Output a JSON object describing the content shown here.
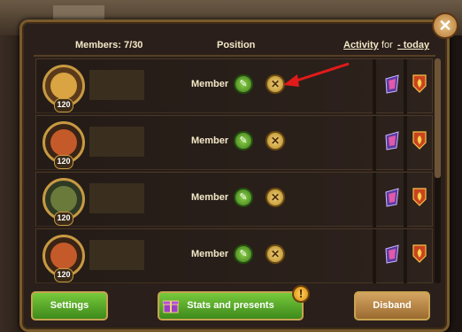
{
  "header": {
    "members": "Members: 7/30",
    "position": "Position",
    "activity": "Activity",
    "for": "for",
    "period": "- today"
  },
  "close_icon": "close-icon",
  "members": [
    {
      "level": "120",
      "role": "Member",
      "avatar_color": "#d9a441"
    },
    {
      "level": "120",
      "role": "Member",
      "avatar_color": "#c45a2a"
    },
    {
      "level": "120",
      "role": "Member",
      "avatar_color": "#6a7a3a"
    },
    {
      "level": "120",
      "role": "Member",
      "avatar_color": "#c45a2a"
    }
  ],
  "buttons": {
    "settings": "Settings",
    "stats": "Stats and presents",
    "disband": "Disband"
  },
  "notice": "!",
  "colors": {
    "green_button": "#5aa82a",
    "gold_frame": "#c79a42",
    "disband": "#b8874a",
    "arrow": "#e01a1a"
  }
}
